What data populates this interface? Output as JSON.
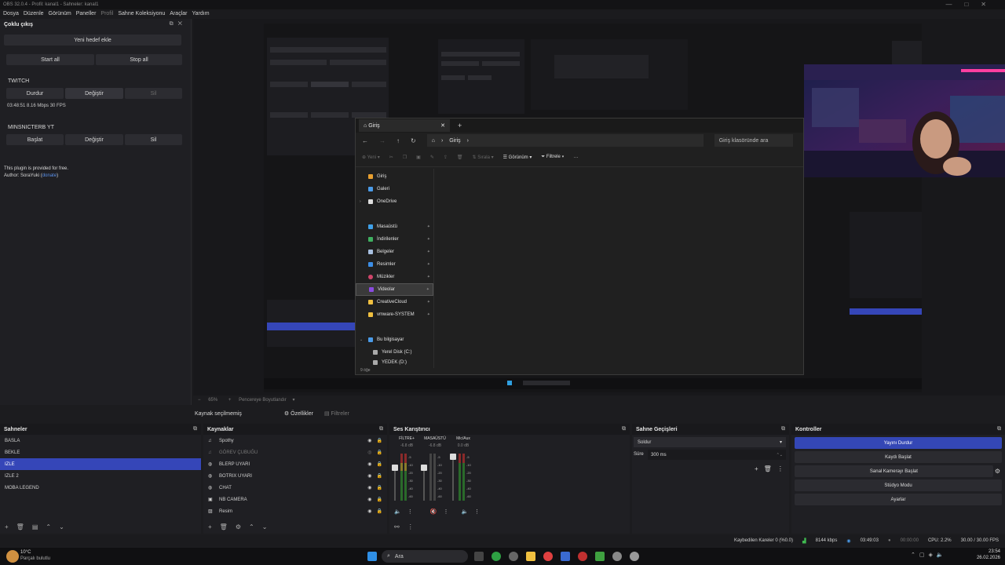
{
  "window": {
    "title": "OBS 32.0.4 - Profil: kanal1 - Sahneler: kanal1"
  },
  "menu": [
    "Dosya",
    "Düzenle",
    "Görünüm",
    "Paneller",
    "Profil",
    "Sahne Koleksiyonu",
    "Araçlar",
    "Yardım"
  ],
  "multi_output": {
    "title": "Çoklu çıkış",
    "add_target": "Yeni hedef ekle",
    "start_all": "Start all",
    "stop_all": "Stop all",
    "targets": [
      {
        "name": "TWITCH",
        "buttons": [
          "Durdur",
          "Değiştir",
          "Sil"
        ],
        "status": "03:48:51  8.16 Mbps  30 FPS"
      },
      {
        "name": "MINSNICTERB YT",
        "buttons": [
          "Başlat",
          "Değiştir",
          "Sil"
        ],
        "status": ""
      }
    ],
    "note": "This plugin is provided for free.",
    "author_prefix": "Author: SoraYuki (",
    "author_link": "donate",
    "author_suffix": ")"
  },
  "explorer": {
    "tab_title": "Giriş",
    "path": "Giriş",
    "search_placeholder": "Giriş klasöründe ara",
    "toolbar": {
      "new": "Yeni",
      "sort": "Sırala",
      "view": "Görünüm",
      "filter": "Filtrele"
    },
    "nav_top": [
      "Giriş",
      "Galeri",
      "OneDrive"
    ],
    "nav_quick": [
      "Masaüstü",
      "İndirilenler",
      "Belgeler",
      "Resimler",
      "Müzikler",
      "Videolar",
      "CreativeCloud",
      "vmware-SYSTEM"
    ],
    "nav_pc": [
      "Bu bilgisayar",
      "Yerel Disk (C:)",
      "YEDEK (D:)"
    ],
    "item_count": "9 öğe",
    "colors": [
      "#4b9be8",
      "#4b9be8",
      "#f0a020",
      "#3c8ee6",
      "#3c8ee6",
      "#5a8fe0",
      "#3c8ee6",
      "#d0456a",
      "#8a4be0",
      "#f0c040",
      "#f0c040"
    ]
  },
  "preview_status": {
    "zoom": "65%",
    "fit": "Pencereye Boyutlandır"
  },
  "context_bar": {
    "selection": "Kaynak seçilmemiş",
    "properties": "Özellikler",
    "filters": "Filtreler"
  },
  "scenes": {
    "title": "Sahneler",
    "items": [
      "BASLA",
      "BEKLE",
      "IZLE",
      "IZLE 2",
      "MOBA LEGEND"
    ],
    "selected": 2
  },
  "sources": {
    "title": "Kaynaklar",
    "items": [
      "Spothy",
      "GÖREV ÇUBUĞU",
      "BLERP UYARI",
      "BOTRIX UYARI",
      "CHAT",
      "NB CAMERA",
      "Resim"
    ]
  },
  "mixer": {
    "title": "Ses Karıştırıcı",
    "channels": [
      {
        "name": "FİLTRE+",
        "db": "-6.8 dB"
      },
      {
        "name": "MASAÜSTÜ",
        "db": "-6.8 dB"
      },
      {
        "name": "Mic/Aux",
        "db": "0.0 dB"
      }
    ]
  },
  "transitions": {
    "title": "Sahne Geçişleri",
    "type": "Soldur",
    "duration_label": "Süre",
    "duration": "300 ms"
  },
  "controls": {
    "title": "Kontroller",
    "buttons": [
      "Yayını Durdur",
      "Kaydı Başlat",
      "Sanal Kamerayı Başlat",
      "Stüdyo Modu",
      "Ayarlar"
    ]
  },
  "status": {
    "dropped": "Kaybedilen Kareler 0 (%0.0)",
    "bitrate": "8144 kbps",
    "stream_time": "03:49:03",
    "rec_time": "00:00:00",
    "cpu": "CPU: 2.2%",
    "fps": "30.00 / 30.00 FPS"
  },
  "taskbar": {
    "weather_temp": "10°C",
    "weather_desc": "Parçalı bulutlu",
    "search": "Ara",
    "time": "23:54",
    "date": "26.02.2026"
  }
}
